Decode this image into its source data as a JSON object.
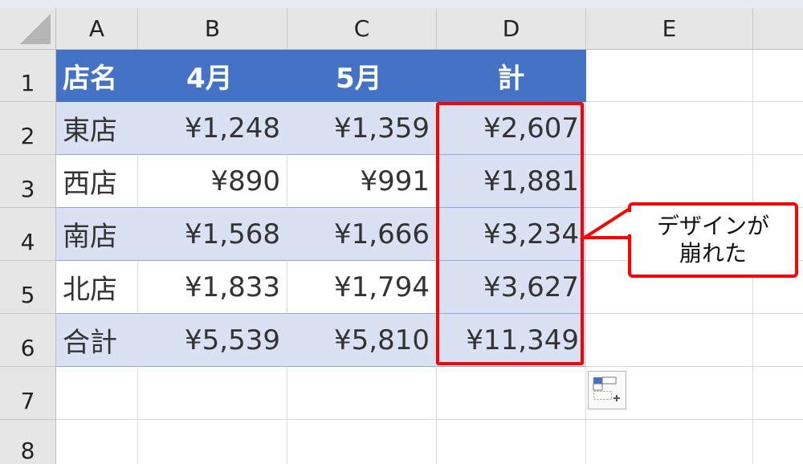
{
  "columns": [
    "A",
    "B",
    "C",
    "D",
    "E"
  ],
  "rows": [
    "1",
    "2",
    "3",
    "4",
    "5",
    "6",
    "7",
    "8"
  ],
  "table": {
    "header": [
      "店名",
      "4月",
      "5月",
      "計"
    ],
    "body": [
      [
        "東店",
        "¥1,248",
        "¥1,359",
        "¥2,607"
      ],
      [
        "西店",
        "¥890",
        "¥991",
        "¥1,881"
      ],
      [
        "南店",
        "¥1,568",
        "¥1,666",
        "¥3,234"
      ],
      [
        "北店",
        "¥1,833",
        "¥1,794",
        "¥3,627"
      ],
      [
        "合計",
        "¥5,539",
        "¥5,810",
        "¥11,349"
      ]
    ]
  },
  "callout": {
    "line1": "デザインが",
    "line2": "崩れた"
  },
  "colors": {
    "header_fill": "#4472c4",
    "band_fill": "#d9e1f2",
    "highlight": "#ff0000"
  },
  "icons": {
    "quick_analysis": "quick-analysis-icon",
    "select_all": "select-all-icon"
  }
}
